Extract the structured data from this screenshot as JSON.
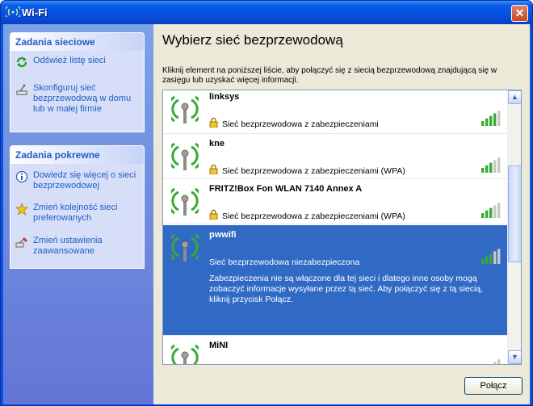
{
  "window": {
    "title": "Wi-Fi",
    "close_glyph": "✕"
  },
  "sidebar": {
    "network_tasks": {
      "header": "Zadania sieciowe",
      "items": [
        {
          "label": "Odśwież listę sieci",
          "icon": "refresh-icon"
        },
        {
          "label": "Skonfiguruj sieć bezprzewodową w domu lub w małej firmie",
          "icon": "setup-network-icon"
        }
      ]
    },
    "related_tasks": {
      "header": "Zadania pokrewne",
      "items": [
        {
          "label": "Dowiedz się więcej o sieci bezprzewodowej",
          "icon": "info-icon"
        },
        {
          "label": "Zmień kolejność sieci preferowanych",
          "icon": "star-icon"
        },
        {
          "label": "Zmień ustawienia zaawansowane",
          "icon": "settings-icon"
        }
      ]
    }
  },
  "main": {
    "heading": "Wybierz sieć bezprzewodową",
    "description": "Kliknij element na poniższej liście, aby połączyć się z siecią bezprzewodową znajdującą się w zasięgu lub uzyskać więcej informacji."
  },
  "networks": [
    {
      "name": "linksys",
      "security": "Sieć bezprzewodowa z zabezpieczeniami",
      "secured": true,
      "signal": 0.8,
      "selected": false
    },
    {
      "name": "kne",
      "security": "Sieć bezprzewodowa z zabezpieczeniami (WPA)",
      "secured": true,
      "signal": 0.6,
      "selected": false
    },
    {
      "name": "FRITZ!Box Fon WLAN 7140 Annex A",
      "security": "Sieć bezprzewodowa z zabezpieczeniami (WPA)",
      "secured": true,
      "signal": 0.6,
      "selected": false
    },
    {
      "name": "pwwifi",
      "security": "Sieć bezprzewodowa niezabezpieczona",
      "secured": false,
      "signal": 0.6,
      "selected": true,
      "note": "Zabezpieczenia nie są włączone dla tej sieci i dlatego inne osoby mogą zobaczyć informacje wysyłane przez tą sieć. Aby połączyć się z tą siecią, kliknij przycisk Połącz."
    },
    {
      "name": "MiNI",
      "security": "",
      "secured": false,
      "signal": 0.4,
      "selected": false
    }
  ],
  "scrollbar": {
    "up_glyph": "▲",
    "down_glyph": "▼"
  },
  "buttons": {
    "connect": "Połącz"
  },
  "colors": {
    "accent": "#215dc6",
    "selection": "#316ac5",
    "signal_lit": "#3aa935",
    "signal_dim": "#c8c8c8"
  }
}
